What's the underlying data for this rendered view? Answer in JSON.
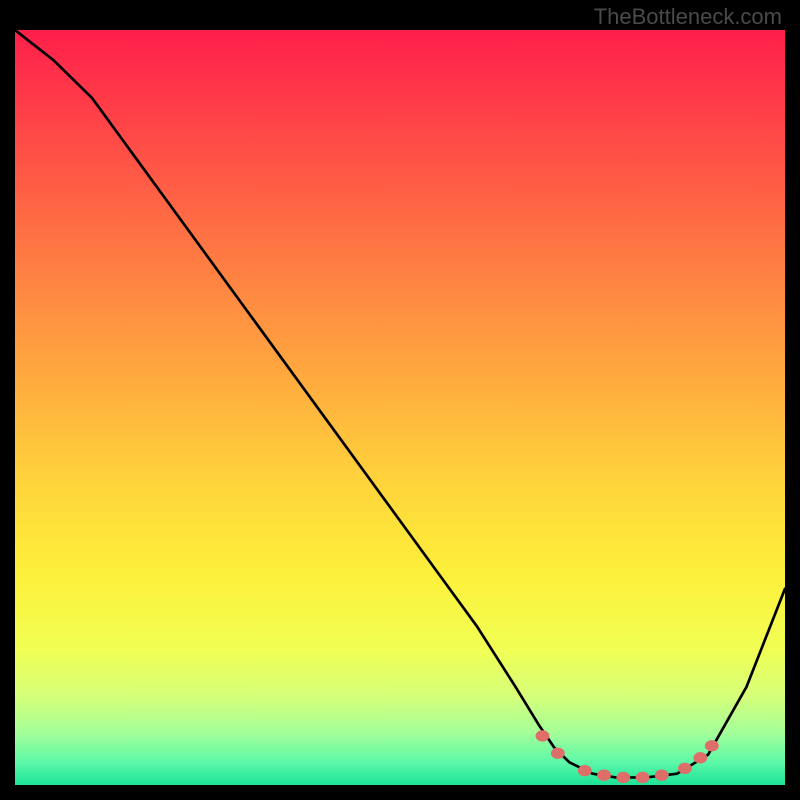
{
  "watermark": "TheBottleneck.com",
  "chart_data": {
    "type": "line",
    "title": "",
    "xlabel": "",
    "ylabel": "",
    "xlim": [
      0,
      100
    ],
    "ylim": [
      0,
      100
    ],
    "series": [
      {
        "name": "bottleneck-curve",
        "x": [
          0,
          5,
          10,
          15,
          20,
          25,
          30,
          35,
          40,
          45,
          50,
          55,
          60,
          65,
          68,
          70,
          72,
          75,
          78,
          82,
          86,
          90,
          95,
          100
        ],
        "y": [
          100,
          96,
          91,
          84,
          77,
          70,
          63,
          56,
          49,
          42,
          35,
          28,
          21,
          13,
          8,
          5,
          3,
          1.5,
          1,
          1,
          1.5,
          4,
          13,
          26
        ]
      }
    ],
    "markers": {
      "name": "highlight-dots",
      "color": "#de6e6a",
      "points": [
        {
          "x": 68.5,
          "y": 6.5
        },
        {
          "x": 70.5,
          "y": 4.2
        },
        {
          "x": 74,
          "y": 1.9
        },
        {
          "x": 76.5,
          "y": 1.3
        },
        {
          "x": 79,
          "y": 1.0
        },
        {
          "x": 81.5,
          "y": 1.0
        },
        {
          "x": 84,
          "y": 1.3
        },
        {
          "x": 87,
          "y": 2.2
        },
        {
          "x": 89,
          "y": 3.6
        },
        {
          "x": 90.5,
          "y": 5.2
        }
      ]
    },
    "gradient_stops": [
      {
        "offset": 0.0,
        "color": "#ff1f4b"
      },
      {
        "offset": 0.15,
        "color": "#ff4c47"
      },
      {
        "offset": 0.3,
        "color": "#ff7a43"
      },
      {
        "offset": 0.45,
        "color": "#ffa73f"
      },
      {
        "offset": 0.6,
        "color": "#ffd43b"
      },
      {
        "offset": 0.72,
        "color": "#fdf03a"
      },
      {
        "offset": 0.82,
        "color": "#f1ff54"
      },
      {
        "offset": 0.88,
        "color": "#d7ff78"
      },
      {
        "offset": 0.93,
        "color": "#a5ff98"
      },
      {
        "offset": 0.97,
        "color": "#5cf8a8"
      },
      {
        "offset": 1.0,
        "color": "#1be397"
      }
    ]
  }
}
